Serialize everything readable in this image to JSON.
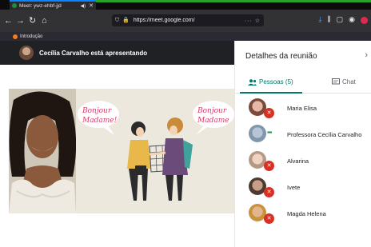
{
  "browser": {
    "tab_title": "Meet: ywz-ehbf-jjd",
    "url": "https://meet.google.com/",
    "bookmark": "Introdução"
  },
  "meet": {
    "presenting_text": "Cecília Carvalho está apresentando"
  },
  "slide": {
    "bubble_left_1": "Bonjour",
    "bubble_left_2": "Madame!",
    "bubble_right_1": "Bonjour",
    "bubble_right_2": "Madame"
  },
  "sidebar": {
    "title": "Detalhes da reunião",
    "tab_people": "Pessoas (5)",
    "tab_chat": "Chat",
    "participants": [
      {
        "name": "Maria Elisa",
        "mic": "muted"
      },
      {
        "name": "Professora Cecília Carvalho",
        "mic": "speaking"
      },
      {
        "name": "Alvarina",
        "mic": "muted"
      },
      {
        "name": "Ivete",
        "mic": "muted"
      },
      {
        "name": "Magda Helena",
        "mic": "muted"
      }
    ]
  },
  "colors": {
    "accent_teal": "#00796b",
    "mic_muted_red": "#d93025",
    "speaking_green": "#1e8e3e",
    "meet_bar": "#202124"
  }
}
